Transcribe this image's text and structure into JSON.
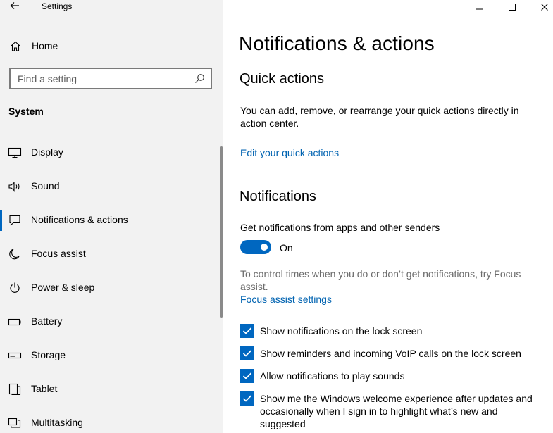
{
  "window": {
    "title": "Settings"
  },
  "sidebar": {
    "home_label": "Home",
    "search_placeholder": "Find a setting",
    "section_title": "System",
    "items": [
      {
        "label": "Display",
        "icon": "monitor-icon"
      },
      {
        "label": "Sound",
        "icon": "speaker-icon"
      },
      {
        "label": "Notifications & actions",
        "icon": "message-icon",
        "selected": true
      },
      {
        "label": "Focus assist",
        "icon": "moon-icon"
      },
      {
        "label": "Power & sleep",
        "icon": "power-icon"
      },
      {
        "label": "Battery",
        "icon": "battery-icon"
      },
      {
        "label": "Storage",
        "icon": "storage-icon"
      },
      {
        "label": "Tablet",
        "icon": "tablet-icon"
      },
      {
        "label": "Multitasking",
        "icon": "multitasking-icon"
      }
    ]
  },
  "main": {
    "page_title": "Notifications & actions",
    "quick_actions": {
      "heading": "Quick actions",
      "description": "You can add, remove, or rearrange your quick actions directly in action center.",
      "link": "Edit your quick actions"
    },
    "notifications": {
      "heading": "Notifications",
      "toggle_caption": "Get notifications from apps and other senders",
      "toggle_state": "On",
      "toggle_on": true,
      "focus_hint": "To control times when you do or don’t get notifications, try Focus assist.",
      "focus_link": "Focus assist settings",
      "checkboxes": [
        {
          "label": "Show notifications on the lock screen",
          "checked": true
        },
        {
          "label": "Show reminders and incoming VoIP calls on the lock screen",
          "checked": true
        },
        {
          "label": "Allow notifications to play sounds",
          "checked": true
        },
        {
          "label": "Show me the Windows welcome experience after updates and occasionally when I sign in to highlight what’s new and suggested",
          "checked": true
        }
      ]
    }
  },
  "colors": {
    "accent": "#0067c0",
    "link": "#0063b1",
    "sidebar_bg": "#f2f2f2"
  }
}
